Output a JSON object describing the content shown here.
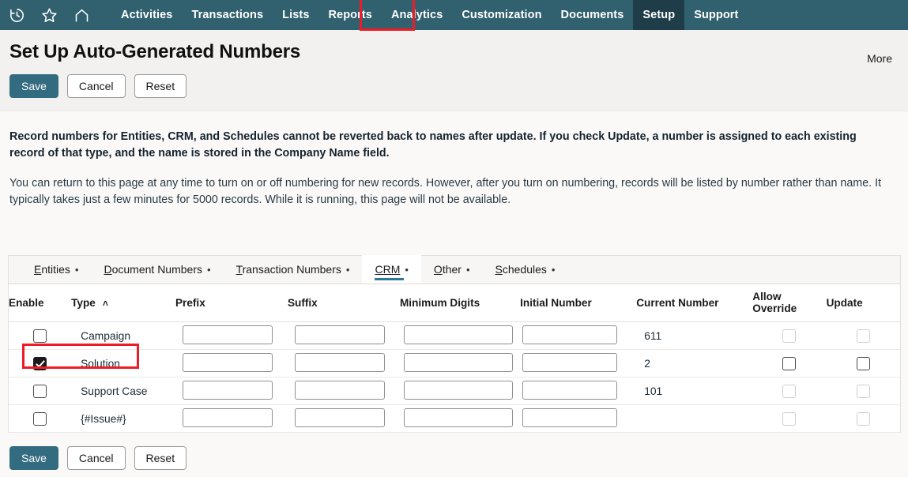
{
  "nav": {
    "icons": [
      {
        "name": "history-icon",
        "label": "Recent Records"
      },
      {
        "name": "star-icon",
        "label": "Shortcuts"
      },
      {
        "name": "home-icon",
        "label": "Home"
      }
    ],
    "items": [
      {
        "label": "Activities",
        "active": false
      },
      {
        "label": "Transactions",
        "active": false
      },
      {
        "label": "Lists",
        "active": false
      },
      {
        "label": "Reports",
        "active": false
      },
      {
        "label": "Analytics",
        "active": false
      },
      {
        "label": "Customization",
        "active": false
      },
      {
        "label": "Documents",
        "active": false
      },
      {
        "label": "Setup",
        "active": true
      },
      {
        "label": "Support",
        "active": false
      }
    ],
    "background_color": "#31606f",
    "active_background_color": "#1f3d49"
  },
  "header": {
    "title": "Set Up Auto-Generated Numbers",
    "more_label": "More",
    "buttons": [
      {
        "label": "Save",
        "style": "primary"
      },
      {
        "label": "Cancel",
        "style": "secondary"
      },
      {
        "label": "Reset",
        "style": "secondary"
      }
    ]
  },
  "messages": {
    "bold": "Record numbers for Entities, CRM, and Schedules cannot be reverted back to names after update. If you check Update, a number is assigned to each existing record of that type, and the name is stored in the Company Name field.",
    "normal": "You can return to this page at any time to turn on or off numbering for new records. However, after you turn on numbering, records will be listed by number rather than name. It typically takes just a few minutes for 5000 records. While it is running, this page will not be available."
  },
  "tabs": [
    {
      "accel": "E",
      "rest": "ntities",
      "full": "Entities",
      "active": false
    },
    {
      "accel": "D",
      "rest": "ocument Numbers",
      "full": "Document Numbers",
      "active": false
    },
    {
      "accel": "T",
      "rest": "ransaction Numbers",
      "full": "Transaction Numbers",
      "active": false
    },
    {
      "accel": "C",
      "rest": "RM",
      "full": "CRM",
      "active": true
    },
    {
      "accel": "O",
      "rest": "ther",
      "full": "Other",
      "active": false
    },
    {
      "accel": "S",
      "rest": "chedules",
      "full": "Schedules",
      "active": false
    }
  ],
  "table": {
    "columns": [
      {
        "key": "enable",
        "label": "Enable"
      },
      {
        "key": "type",
        "label": "Type",
        "sort": "asc",
        "sort_glyph": "˄"
      },
      {
        "key": "prefix",
        "label": "Prefix"
      },
      {
        "key": "suffix",
        "label": "Suffix"
      },
      {
        "key": "mindig",
        "label": "Minimum Digits"
      },
      {
        "key": "initial",
        "label": "Initial Number"
      },
      {
        "key": "current",
        "label": "Current Number"
      },
      {
        "key": "allow",
        "label": "Allow Override"
      },
      {
        "key": "update",
        "label": "Update"
      }
    ],
    "rows": [
      {
        "type": "Campaign",
        "enable_checked": false,
        "prefix": "",
        "suffix": "",
        "mindig": "",
        "initial": "",
        "current": "611",
        "allow_checked": false,
        "allow_disabled": true,
        "update_checked": false,
        "update_disabled": true,
        "highlighted": false
      },
      {
        "type": "Solution",
        "enable_checked": true,
        "prefix": "",
        "suffix": "",
        "mindig": "",
        "initial": "",
        "current": "2",
        "allow_checked": false,
        "allow_disabled": false,
        "update_checked": false,
        "update_disabled": false,
        "highlighted": true
      },
      {
        "type": "Support Case",
        "enable_checked": false,
        "prefix": "",
        "suffix": "",
        "mindig": "",
        "initial": "",
        "current": "101",
        "allow_checked": false,
        "allow_disabled": true,
        "update_checked": false,
        "update_disabled": true,
        "highlighted": false
      },
      {
        "type": "{#Issue#}",
        "enable_checked": false,
        "prefix": "",
        "suffix": "",
        "mindig": "",
        "initial": "",
        "current": "",
        "allow_checked": false,
        "allow_disabled": true,
        "update_checked": false,
        "update_disabled": true,
        "highlighted": false
      }
    ]
  },
  "footer": {
    "buttons": [
      {
        "label": "Save",
        "style": "primary"
      },
      {
        "label": "Cancel",
        "style": "secondary"
      },
      {
        "label": "Reset",
        "style": "secondary"
      }
    ]
  },
  "annotations": {
    "color": "#ee1c25",
    "targets": [
      "tab-crm",
      "row-solution-enable"
    ]
  }
}
